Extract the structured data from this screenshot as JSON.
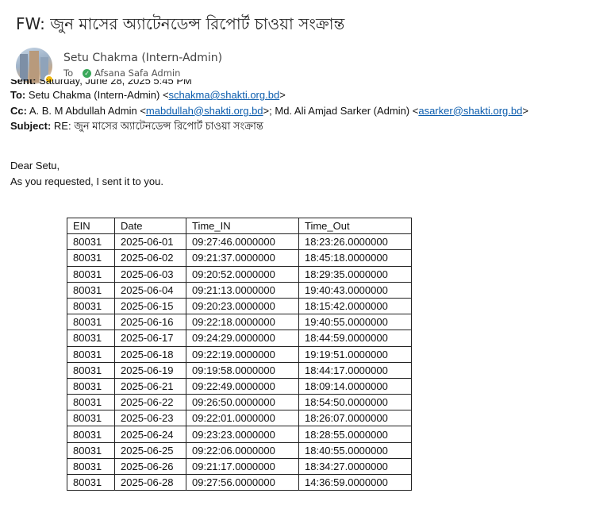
{
  "email": {
    "subject": "FW: জুন মাসের অ্যাটেনডেন্স রিপোর্ট চাওয়া সংক্রান্ত",
    "sender": "Setu Chakma (Intern-Admin)",
    "to_label": "To",
    "recipient": "Afsana Safa Admin"
  },
  "forwarded": {
    "sent_label": "Sent:",
    "sent_value": "Saturday, June 28, 2025 5:45 PM",
    "to_label": "To:",
    "to_name": "Setu Chakma (Intern-Admin) <",
    "to_email": "schakma@shakti.org.bd",
    "to_close": ">",
    "cc_label": "Cc:",
    "cc_name1": "A. B. M Abdullah Admin <",
    "cc_email1": "mabdullah@shakti.org.bd",
    "cc_mid": ">; Md. Ali Amjad Sarker (Admin) <",
    "cc_email2": "asarker@shakti.org.bd",
    "cc_close": ">",
    "subject_label": "Subject:",
    "subject_value": "RE: জুন মাসের অ্যাটেনডেন্স রিপোর্ট চাওয়া সংক্রান্ত"
  },
  "body": {
    "greeting": "Dear Setu,",
    "line1": "As you requested, I sent it to you."
  },
  "table": {
    "headers": [
      "EIN",
      "Date",
      "Time_IN",
      "Time_Out"
    ],
    "rows": [
      [
        "80031",
        "2025-06-01",
        "09:27:46.0000000",
        "18:23:26.0000000"
      ],
      [
        "80031",
        "2025-06-02",
        "09:21:37.0000000",
        "18:45:18.0000000"
      ],
      [
        "80031",
        "2025-06-03",
        "09:20:52.0000000",
        "18:29:35.0000000"
      ],
      [
        "80031",
        "2025-06-04",
        "09:21:13.0000000",
        "19:40:43.0000000"
      ],
      [
        "80031",
        "2025-06-15",
        "09:20:23.0000000",
        "18:15:42.0000000"
      ],
      [
        "80031",
        "2025-06-16",
        "09:22:18.0000000",
        "19:40:55.0000000"
      ],
      [
        "80031",
        "2025-06-17",
        "09:24:29.0000000",
        "18:44:59.0000000"
      ],
      [
        "80031",
        "2025-06-18",
        "09:22:19.0000000",
        "19:19:51.0000000"
      ],
      [
        "80031",
        "2025-06-19",
        "09:19:58.0000000",
        "18:44:17.0000000"
      ],
      [
        "80031",
        "2025-06-21",
        "09:22:49.0000000",
        "18:09:14.0000000"
      ],
      [
        "80031",
        "2025-06-22",
        "09:26:50.0000000",
        "18:54:50.0000000"
      ],
      [
        "80031",
        "2025-06-23",
        "09:22:01.0000000",
        "18:26:07.0000000"
      ],
      [
        "80031",
        "2025-06-24",
        "09:23:23.0000000",
        "18:28:55.0000000"
      ],
      [
        "80031",
        "2025-06-25",
        "09:22:06.0000000",
        "18:40:55.0000000"
      ],
      [
        "80031",
        "2025-06-26",
        "09:21:17.0000000",
        "18:34:27.0000000"
      ],
      [
        "80031",
        "2025-06-28",
        "09:27:56.0000000",
        "14:36:59.0000000"
      ]
    ]
  }
}
